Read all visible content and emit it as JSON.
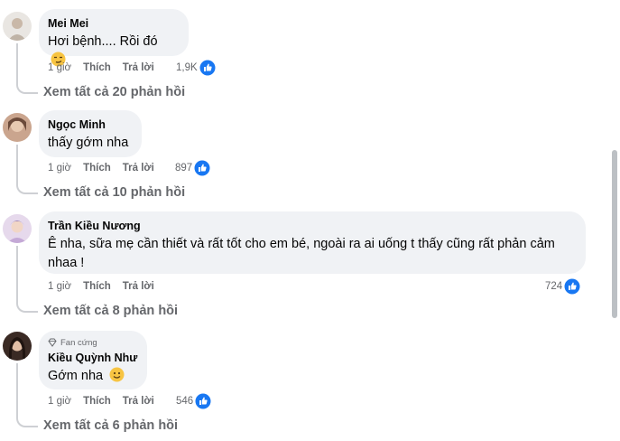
{
  "comments": [
    {
      "name": "Mei Mei",
      "text": "Hơi bệnh.... Rồi đó",
      "time": "1 giờ",
      "like": "Thích",
      "reply": "Trả lời",
      "reactions": "1,9K",
      "replies": "Xem tất cả 20 phản hồi"
    },
    {
      "name": "Ngọc Minh",
      "text": "thấy gớm nha",
      "time": "1 giờ",
      "like": "Thích",
      "reply": "Trả lời",
      "reactions": "897",
      "replies": "Xem tất cả 10 phản hồi"
    },
    {
      "name": "Trần Kiều Nương",
      "text": "Ê nha, sữa mẹ cần thiết và rất tốt cho em bé, ngoài ra ai uống t thấy cũng rất phản cảm nhaa !",
      "time": "1 giờ",
      "like": "Thích",
      "reply": "Trả lời",
      "reactions": "724",
      "replies": "Xem tất cả 8 phản hồi"
    },
    {
      "badge": "Fan cứng",
      "name": "Kiều Quỳnh Như",
      "text": "Gớm nha",
      "time": "1 giờ",
      "like": "Thích",
      "reply": "Trả lời",
      "reactions": "546",
      "replies": "Xem tất cả 6 phản hồi"
    }
  ],
  "colors": {
    "bubble": "#f0f2f5",
    "secondary_text": "#65676b",
    "like_blue": "#1877f2"
  }
}
